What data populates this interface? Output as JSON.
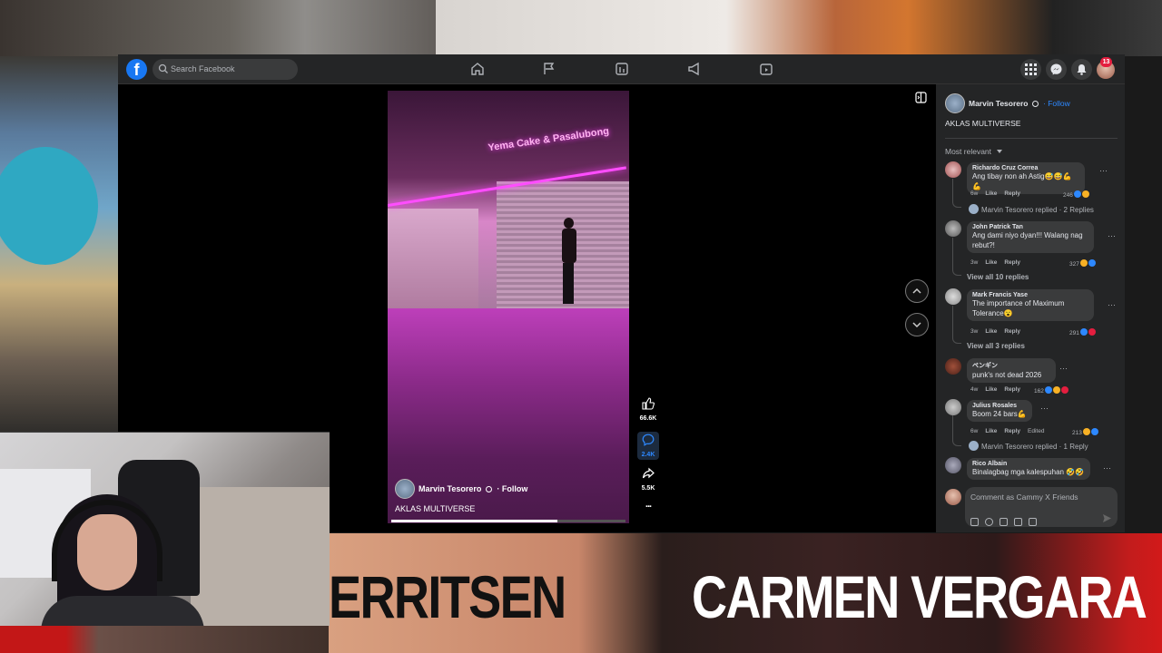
{
  "header": {
    "logo_letter": "f",
    "search_placeholder": "Search Facebook",
    "nav_icons": [
      "home-icon",
      "flag-icon",
      "marketplace-icon",
      "megaphone-icon",
      "gaming-icon"
    ],
    "right_icons": [
      "menu-grid-icon",
      "messenger-icon",
      "bell-icon"
    ],
    "notification_count": "13"
  },
  "video": {
    "author": "Marvin Tesorero",
    "follow": "· Follow",
    "caption": "AKLAS MULTIVERSE",
    "sign_text": "Yema Cake & Pasalubong",
    "progress": 0.71,
    "actions": {
      "likes": "66.6K",
      "comments": "2.4K",
      "shares": "5.5K",
      "more": "..."
    }
  },
  "panel": {
    "author": "Marvin Tesorero",
    "follow": "· Follow",
    "caption": "AKLAS MULTIVERSE",
    "sort_label": "Most relevant",
    "comments": [
      {
        "name": "Richardo Cruz Correa",
        "text": "Ang tibay non ah Astig😅😅💪💪",
        "time": "6w",
        "actions": [
          "Like",
          "Reply"
        ],
        "count": "246",
        "replies": "Marvin Tesorero replied · 2 Replies"
      },
      {
        "name": "John Patrick Tan",
        "text": "Ang dami niyo dyan!!! Walang nag rebut?!",
        "time": "3w",
        "actions": [
          "Like",
          "Reply"
        ],
        "count": "327",
        "view_all": "View all 10 replies"
      },
      {
        "name": "Mark Francis Yase",
        "text": "The importance of Maximum Tolerance😮",
        "time": "3w",
        "actions": [
          "Like",
          "Reply"
        ],
        "count": "291",
        "view_all": "View all 3 replies"
      },
      {
        "name": "ペンギン",
        "text": "punk's not dead 2026",
        "time": "4w",
        "actions": [
          "Like",
          "Reply"
        ],
        "count": "162"
      },
      {
        "name": "Julius Rosales",
        "text": "Boom 24 bars💪",
        "time": "6w",
        "actions": [
          "Like",
          "Reply",
          "Edited"
        ],
        "count": "213",
        "replies": "Marvin Tesorero replied · 1 Reply"
      },
      {
        "name": "Rico Albain",
        "text": "Binalagbag mga kalespuhan 🤣🤣"
      }
    ],
    "compose_placeholder": "Comment as Cammy X Friends"
  },
  "overlay": {
    "name_left": "ERRITSEN",
    "name_right": "CARMEN VERGARA"
  },
  "colors": {
    "fb_blue": "#1877f2",
    "link_blue": "#2d88ff",
    "panel_bg": "#242526",
    "bubble_bg": "#3a3b3c"
  }
}
